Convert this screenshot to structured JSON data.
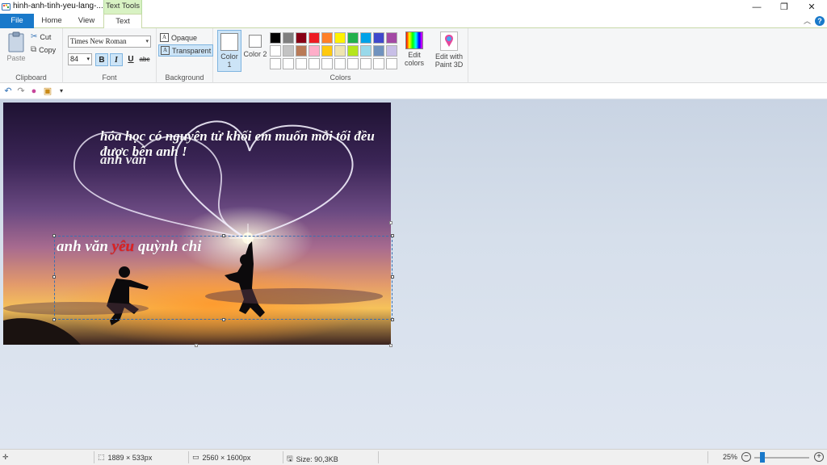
{
  "window": {
    "title": "hinh-anh-tinh-yeu-lang-...",
    "context_tab": "Text Tools",
    "minimize": "—",
    "restore": "❐",
    "close": "✕"
  },
  "tabs": [
    {
      "label": "File"
    },
    {
      "label": "Home"
    },
    {
      "label": "View"
    },
    {
      "label": "Text"
    }
  ],
  "ribbon": {
    "clipboard": {
      "paste": "Paste",
      "cut": "Cut",
      "copy": "Copy",
      "label": "Clipboard"
    },
    "font": {
      "family": "Times New Roman",
      "size": "84",
      "bold": "B",
      "italic": "I",
      "underline": "U",
      "strikethrough": "abc",
      "label": "Font"
    },
    "background": {
      "opaque": "Opaque",
      "transparent": "Transparent",
      "label": "Background"
    },
    "colors": {
      "color1": "Color 1",
      "color2": "Color 2",
      "edit_colors": "Edit colors",
      "label": "Colors",
      "palette": [
        "#000000",
        "#7f7f7f",
        "#880015",
        "#ed1c24",
        "#ff7f27",
        "#fff200",
        "#22b14c",
        "#00a2e8",
        "#3f48cc",
        "#a349a4",
        "#ffffff",
        "#c3c3c3",
        "#b97a57",
        "#ffaec9",
        "#ffc90e",
        "#efe4b0",
        "#b5e61d",
        "#99d9ea",
        "#7092be",
        "#c8bfe7",
        "#ffffff",
        "#ffffff",
        "#ffffff",
        "#ffffff",
        "#ffffff",
        "#ffffff",
        "#ffffff",
        "#ffffff",
        "#ffffff",
        "#ffffff"
      ]
    },
    "paint3d": {
      "label": "Edit with Paint 3D"
    }
  },
  "canvas": {
    "line1": "hóa học có nguyên tử khối em muốn mỗi tối đều",
    "line2": "được bên anh !",
    "line3": "anh văn",
    "main_before": "anh văn ",
    "main_highlight": "yêu",
    "main_after": " quỳnh chi"
  },
  "status": {
    "selection_size": "1889 × 533px",
    "image_size": "2560 × 1600px",
    "file_size": "Size: 90,3KB",
    "zoom": "25%"
  }
}
